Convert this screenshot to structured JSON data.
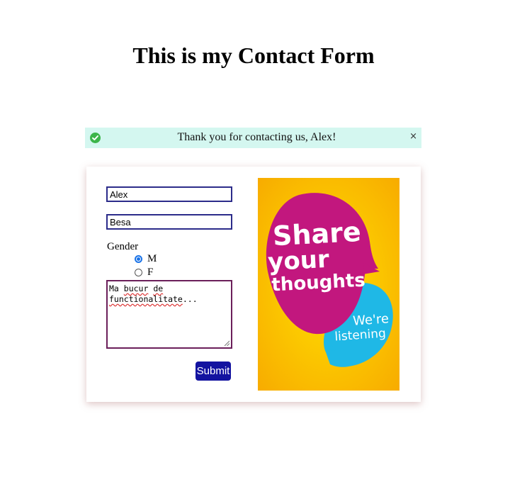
{
  "page": {
    "title": "This is my Contact Form"
  },
  "alert": {
    "icon": "check-circle-icon",
    "message": "Thank you for contacting us, Alex!",
    "close_glyph": "×",
    "background": "#d4f7f0"
  },
  "form": {
    "first_name_value": "Alex",
    "last_name_value": "Besa",
    "gender_label": "Gender",
    "gender_options": [
      {
        "label": "M",
        "checked": true
      },
      {
        "label": "F",
        "checked": false
      }
    ],
    "message_line1_a": "Ma ",
    "message_line1_b": "bucur",
    "message_line1_c": " ",
    "message_line1_d": "de",
    "message_line2_a": "functionalitate",
    "message_line2_b": "...",
    "submit_label": "Submit"
  },
  "poster": {
    "line1": "Share",
    "line2": "your",
    "line3": "thoughts",
    "line4": "We're",
    "line5": "listening"
  },
  "colors": {
    "accent": "#1313a0",
    "poster_bg": "#fbb800",
    "bubble_magenta": "#c2177e",
    "bubble_cyan": "#1fb8e6"
  }
}
